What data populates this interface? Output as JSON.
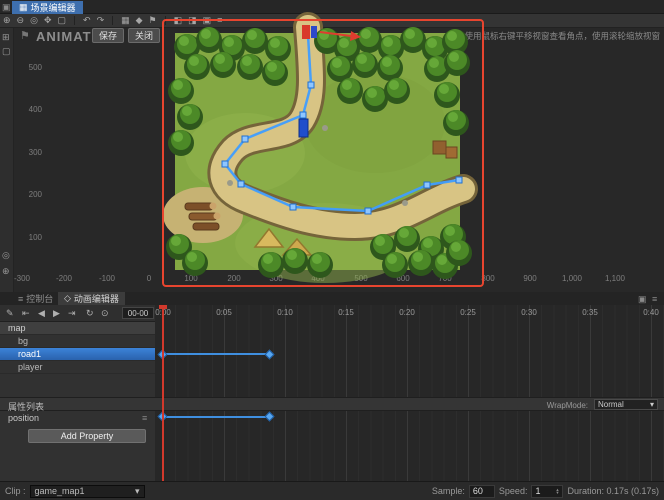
{
  "titlebar": {
    "tab": "场景编辑器",
    "app_icon": "▣"
  },
  "toolbar": {
    "icons": [
      {
        "name": "zoom-in",
        "glyph": "⊕"
      },
      {
        "name": "zoom-out",
        "glyph": "⊖"
      },
      {
        "name": "zoom-reset",
        "glyph": "◎"
      },
      {
        "name": "pan-tool",
        "glyph": "✥"
      },
      {
        "name": "rect-select",
        "glyph": "▢"
      },
      {
        "name": "undo",
        "glyph": "↶"
      },
      {
        "name": "redo",
        "glyph": "↷"
      },
      {
        "name": "grid",
        "glyph": "▦"
      },
      {
        "name": "snap",
        "glyph": "◆"
      },
      {
        "name": "flag",
        "glyph": "⚑"
      },
      {
        "name": "split-left",
        "glyph": "◧"
      },
      {
        "name": "split-right",
        "glyph": "◨"
      },
      {
        "name": "snapshot",
        "glyph": "▣"
      },
      {
        "name": "list",
        "glyph": "≡"
      }
    ]
  },
  "leftstrip": {
    "icons": [
      {
        "name": "grid",
        "glyph": "⊞"
      },
      {
        "name": "select",
        "glyph": "▢"
      },
      {
        "name": "zoom",
        "glyph": "◎"
      },
      {
        "name": "magnify",
        "glyph": "⊕"
      }
    ]
  },
  "scene": {
    "watermark": "ANIMATE",
    "flag_glyph": "⚑",
    "save_button": "保存",
    "close_button": "关闭",
    "hint": "使用鼠标右键平移视窗查看角点，使用滚轮缩放视窗",
    "ruler_vertical": [
      "500",
      "400",
      "300",
      "200",
      "100"
    ],
    "ruler_horizontal": [
      "-300",
      "-200",
      "-100",
      "0",
      "100",
      "200",
      "300",
      "400",
      "500",
      "600",
      "700",
      "800",
      "900",
      "1,000",
      "1,100"
    ]
  },
  "timeline": {
    "tabs": [
      {
        "label": "控制台",
        "icon": "≡"
      },
      {
        "label": "动画编辑器",
        "icon": "◇"
      }
    ],
    "panel_icons": [
      {
        "name": "maximize",
        "glyph": "▣"
      },
      {
        "name": "menu",
        "glyph": "≡"
      }
    ],
    "controls": {
      "icons": [
        {
          "name": "edit-keyframe",
          "glyph": "✎"
        },
        {
          "name": "skip-to-start",
          "glyph": "⇤"
        },
        {
          "name": "step-back",
          "glyph": "◀"
        },
        {
          "name": "play",
          "glyph": "▶"
        },
        {
          "name": "skip-to-end",
          "glyph": "⇥"
        },
        {
          "name": "loop",
          "glyph": "↻"
        },
        {
          "name": "add-keyframe",
          "glyph": "⊙"
        }
      ]
    },
    "time_field": "00-00",
    "ruler": [
      "0:00",
      "0:05",
      "0:10",
      "0:15",
      "0:20",
      "0:25",
      "0:30",
      "0:35",
      "0:40"
    ],
    "nodes": [
      {
        "name": "map"
      },
      {
        "name": "bg"
      },
      {
        "name": "road1"
      },
      {
        "name": "player"
      }
    ],
    "selected_node": "road1",
    "keyframe_times": [
      "0:00",
      "0:10"
    ],
    "properties_header": "属性列表",
    "properties": [
      {
        "name": "position",
        "menu_glyph": "≡"
      }
    ],
    "add_property_button": "Add Property",
    "wrapmode_label": "WrapMode:",
    "wrapmode_value": "Normal",
    "dropdown_arrow": "▾"
  },
  "statusbar": {
    "clip_label": "Clip :",
    "clip_value": "game_map1",
    "sample_label": "Sample:",
    "sample_value": "60",
    "speed_label": "Speed:",
    "speed_value": "1",
    "duration_text": "Duration: 0.17s (0.17s)"
  },
  "colors": {
    "accent_blue": "#3f9dff",
    "selection_blue": "#2f72c0",
    "playhead_red": "#d2392c",
    "anim_border_red": "#e8452f"
  }
}
